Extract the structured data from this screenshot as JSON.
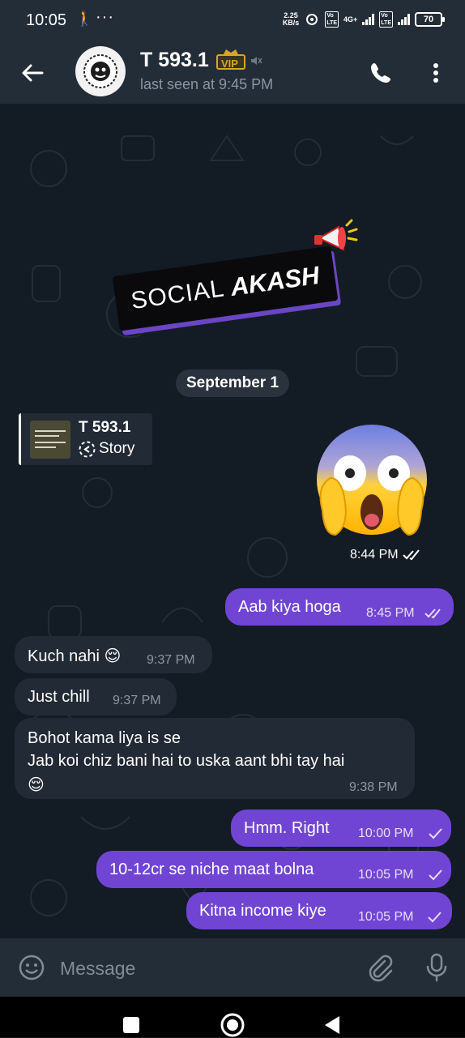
{
  "status_bar": {
    "time": "10:05",
    "net_speed_value": "2.25",
    "net_speed_unit": "KB/s",
    "network": "4G+",
    "battery": "70"
  },
  "header": {
    "contact_name": "T 593.1",
    "badge": "VIP",
    "last_seen": "last seen at 9:45 PM"
  },
  "banner": {
    "word1": "SOCIAL",
    "word2": "AKASH"
  },
  "date_separator": "September 1",
  "story": {
    "name": "T 593.1",
    "label": "Story"
  },
  "emoji_message": {
    "time": "8:44 PM"
  },
  "messages": [
    {
      "dir": "out",
      "text": "Aab kiya hoga",
      "time": "8:45 PM"
    },
    {
      "dir": "in",
      "text": "Kuch nahi 😌",
      "time": "9:37 PM"
    },
    {
      "dir": "in",
      "text": "Just chill",
      "time": "9:37 PM"
    },
    {
      "dir": "in",
      "line1": "Bohot kama liya is se",
      "line2": "Jab koi chiz bani hai to uska aant bhi tay hai",
      "line3": "😌",
      "time": "9:38 PM"
    },
    {
      "dir": "out",
      "text": "Hmm.  Right",
      "time": "10:00 PM"
    },
    {
      "dir": "out",
      "text": "10-12cr se niche maat bolna",
      "time": "10:05 PM"
    },
    {
      "dir": "out",
      "text": "Kitna income kiye",
      "time": "10:05 PM"
    }
  ],
  "composer": {
    "placeholder": "Message"
  },
  "colors": {
    "header_bg": "#232d38",
    "chat_bg": "#131b24",
    "incoming_bubble": "#212a35",
    "outgoing_bubble": "#7145d3",
    "vip_gold": "#d8a52a"
  },
  "icons": [
    "walk-icon",
    "back-arrow-icon",
    "vip-crown-icon",
    "mute-icon",
    "phone-icon",
    "more-vert-icon",
    "megaphone-icon",
    "story-reply-icon",
    "screaming-face-emoji",
    "double-check-icon",
    "single-check-icon",
    "smile-icon",
    "attach-icon",
    "mic-icon"
  ]
}
